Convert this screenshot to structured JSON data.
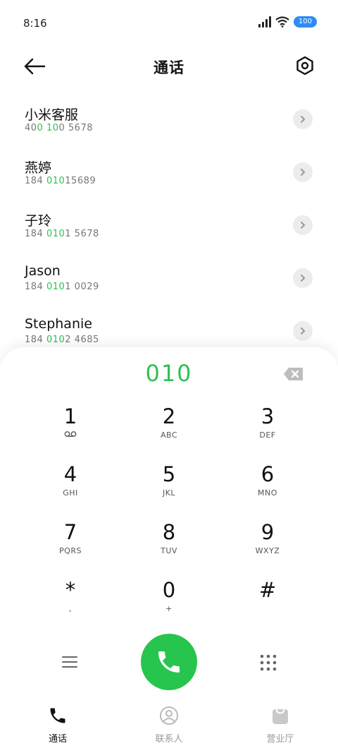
{
  "status": {
    "time": "8:16",
    "battery": "100"
  },
  "header": {
    "title": "通话"
  },
  "contacts": [
    {
      "name": "小米客服",
      "num_pre": "40",
      "num_hl": "0 10",
      "num_post": "0 5678"
    },
    {
      "name": "燕婷",
      "num_pre": "184 ",
      "num_hl": "010",
      "num_post": "15689"
    },
    {
      "name": "子玲",
      "num_pre": "184 ",
      "num_hl": "010",
      "num_post": "1 5678"
    },
    {
      "name": "Jason",
      "num_pre": "184 ",
      "num_hl": "010",
      "num_post": "1 0029"
    },
    {
      "name": "Stephanie",
      "num_pre": "184 ",
      "num_hl": "010",
      "num_post": "2 4685"
    }
  ],
  "dialer": {
    "entered": "010",
    "keys": [
      {
        "digit": "1",
        "letters": ""
      },
      {
        "digit": "2",
        "letters": "ABC"
      },
      {
        "digit": "3",
        "letters": "DEF"
      },
      {
        "digit": "4",
        "letters": "GHI"
      },
      {
        "digit": "5",
        "letters": "JKL"
      },
      {
        "digit": "6",
        "letters": "MNO"
      },
      {
        "digit": "7",
        "letters": "PQRS"
      },
      {
        "digit": "8",
        "letters": "TUV"
      },
      {
        "digit": "9",
        "letters": "WXYZ"
      },
      {
        "digit": "*",
        "letters": ","
      },
      {
        "digit": "0",
        "letters": "+"
      },
      {
        "digit": "#",
        "letters": ""
      }
    ]
  },
  "tabs": [
    {
      "label": "通话",
      "icon": "phone-icon"
    },
    {
      "label": "联系人",
      "icon": "person-icon"
    },
    {
      "label": "营业厅",
      "icon": "bag-icon"
    }
  ],
  "colors": {
    "accent": "#2fc054",
    "call": "#27c54d",
    "battery": "#2f8cf3"
  }
}
